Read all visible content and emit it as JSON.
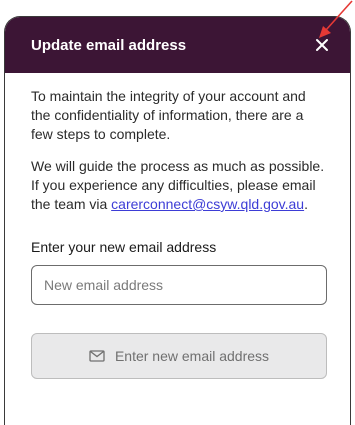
{
  "modal": {
    "title": "Update email address",
    "close_icon": "close-icon",
    "paragraph_1": "To maintain the integrity of your account and the confidentiality of information, there are a few steps to complete.",
    "paragraph_2_prefix": "We will guide the process as much as possible. If you experience any difficulties, please email the team via ",
    "email_link": "carerconnect@csyw.qld.gov.au",
    "paragraph_2_suffix": ".",
    "field_label": "Enter your new email address",
    "input_placeholder": "New email address",
    "input_value": "",
    "submit_icon": "mail-icon",
    "submit_label": "Enter new email address",
    "submit_enabled": false
  },
  "annotation": {
    "arrow_icon": "red-arrow-icon",
    "arrow_color": "#e53935"
  },
  "colors": {
    "header_bg": "#3c1535",
    "link": "#3d3dd6",
    "button_disabled_bg": "#e9e9ea"
  }
}
